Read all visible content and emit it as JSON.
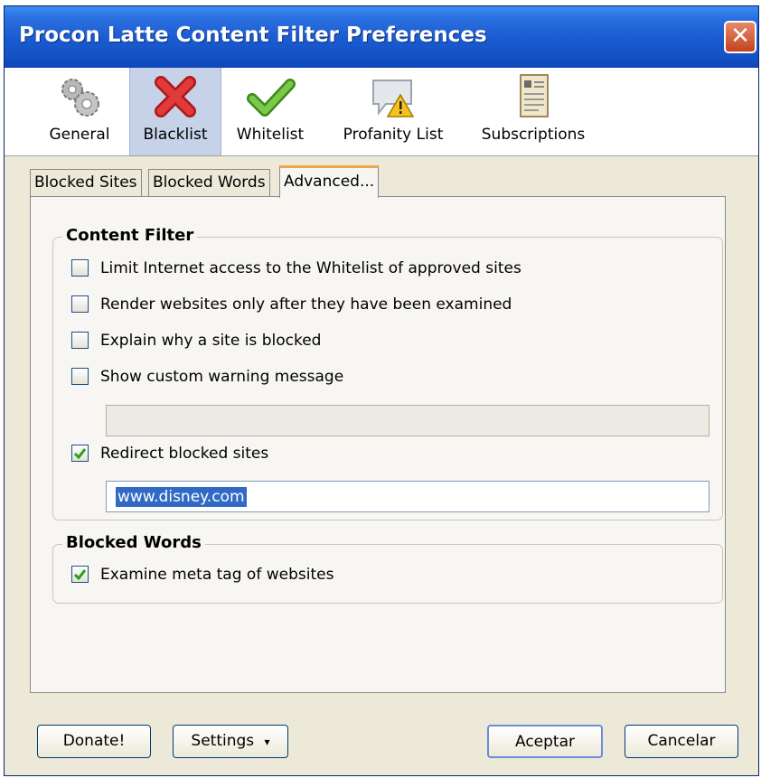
{
  "window": {
    "title": "Procon Latte Content Filter Preferences"
  },
  "toolbar": {
    "items": [
      {
        "label": "General",
        "icon": "gears-icon"
      },
      {
        "label": "Blacklist",
        "icon": "red-x-icon",
        "selected": true
      },
      {
        "label": "Whitelist",
        "icon": "green-check-icon"
      },
      {
        "label": "Profanity List",
        "icon": "warning-speech-bubble-icon"
      },
      {
        "label": "Subscriptions",
        "icon": "document-card-icon"
      }
    ]
  },
  "tabs": [
    {
      "label": "Blocked Sites"
    },
    {
      "label": "Blocked Words"
    },
    {
      "label": "Advanced...",
      "active": true
    }
  ],
  "content_filter": {
    "legend": "Content Filter",
    "options": [
      {
        "label": "Limit Internet access to the Whitelist of approved sites",
        "checked": false
      },
      {
        "label": "Render websites only after they have been examined",
        "checked": false
      },
      {
        "label": "Explain why a site is blocked",
        "checked": false
      },
      {
        "label": "Show custom warning message",
        "checked": false
      }
    ],
    "warning_message_value": "",
    "redirect": {
      "label": "Redirect blocked sites",
      "checked": true,
      "url_value": "www.disney.com"
    }
  },
  "blocked_words": {
    "legend": "Blocked Words",
    "option": {
      "label": "Examine meta tag of websites",
      "checked": true
    }
  },
  "buttons": {
    "donate": "Donate!",
    "settings": "Settings",
    "settings_arrow": "▾",
    "accept": "Aceptar",
    "cancel": "Cancelar"
  },
  "colors": {
    "titlebar": "#1a5ad0",
    "close_button": "#d4552e",
    "active_tab_highlight": "#f2a44a",
    "selection": "#316ac5"
  }
}
